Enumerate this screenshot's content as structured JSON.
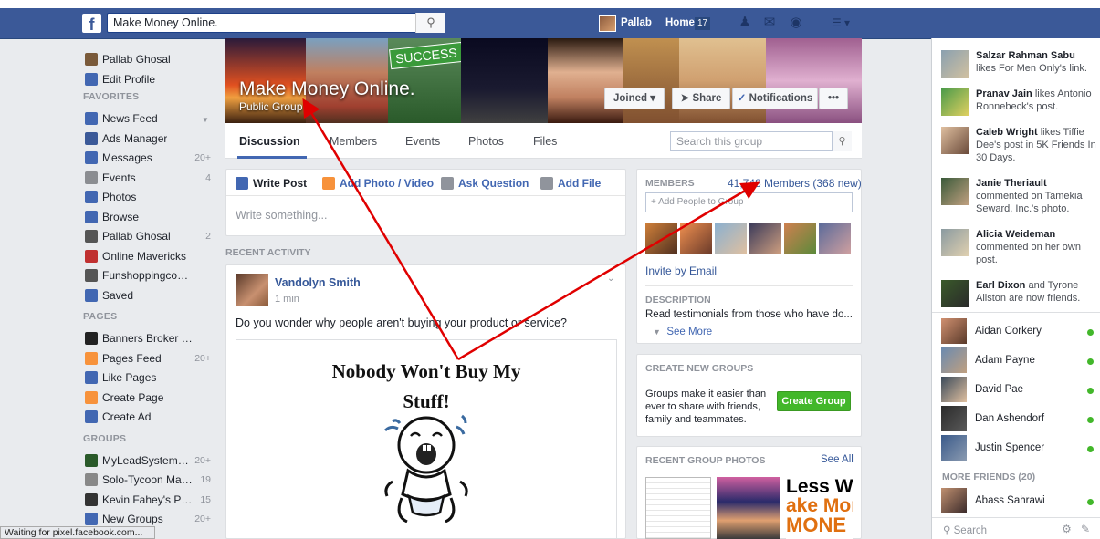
{
  "topbar": {
    "search_value": "Make Money Online.",
    "user_name": "Pallab",
    "home_label": "Home",
    "home_count": "17",
    "colors": {
      "brand": "#3b5998"
    }
  },
  "left_nav": {
    "profile": [
      {
        "label": "Pallab Ghosal",
        "icon": "profile-avatar"
      },
      {
        "label": "Edit Profile",
        "icon": "pencil-icon"
      }
    ],
    "favorites_heading": "FAVORITES",
    "favorites": [
      {
        "label": "News Feed",
        "count": "",
        "icon": "news-feed-icon"
      },
      {
        "label": "Ads Manager",
        "count": "",
        "icon": "chart-icon"
      },
      {
        "label": "Messages",
        "count": "20+",
        "icon": "messages-icon"
      },
      {
        "label": "Events",
        "count": "4",
        "icon": "calendar-icon"
      },
      {
        "label": "Photos",
        "count": "",
        "icon": "photos-icon"
      },
      {
        "label": "Browse",
        "count": "",
        "icon": "browse-icon"
      },
      {
        "label": "Pallab Ghosal",
        "count": "2",
        "icon": "page-icon"
      },
      {
        "label": "Online Mavericks",
        "count": "",
        "icon": "mavericks-icon"
      },
      {
        "label": "Funshoppingcoach",
        "count": "",
        "icon": "group-icon"
      },
      {
        "label": "Saved",
        "count": "",
        "icon": "bookmark-icon"
      }
    ],
    "pages_heading": "PAGES",
    "pages": [
      {
        "label": "Banners Broker India",
        "count": "",
        "icon": "page-icon"
      },
      {
        "label": "Pages Feed",
        "count": "20+",
        "icon": "megaphone-icon"
      },
      {
        "label": "Like Pages",
        "count": "",
        "icon": "like-icon"
      },
      {
        "label": "Create Page",
        "count": "",
        "icon": "plus-icon"
      },
      {
        "label": "Create Ad",
        "count": "",
        "icon": "chart-icon"
      }
    ],
    "groups_heading": "GROUPS",
    "groups": [
      {
        "label": "MyLeadSystemPR...",
        "count": "20+",
        "icon": "group-icon"
      },
      {
        "label": "Solo-Tycoon Maste...",
        "count": "19",
        "icon": "group-icon"
      },
      {
        "label": "Kevin Fahey's PRIV...",
        "count": "15",
        "icon": "group-icon"
      },
      {
        "label": "New Groups",
        "count": "20+",
        "icon": "groups-icon"
      }
    ]
  },
  "group": {
    "name": "Make Money Online.",
    "privacy": "Public Group",
    "cover_text": "SUCCESS",
    "joined": "Joined",
    "share": "Share",
    "notifications": "Notifications",
    "more": "•••",
    "tabs": [
      "Discussion",
      "Members",
      "Events",
      "Photos",
      "Files"
    ],
    "search_placeholder": "Search this group"
  },
  "composer": {
    "write_post": "Write Post",
    "add_photo": "Add Photo / Video",
    "ask_question": "Ask Question",
    "add_file": "Add File",
    "placeholder": "Write something..."
  },
  "activity": {
    "heading": "RECENT ACTIVITY",
    "post": {
      "author": "Vandolyn Smith",
      "time": "1 min",
      "text": "Do you wonder why people aren't buying your product or service?",
      "image_title_1": "Nobody Won't Buy My",
      "image_title_2": "Stuff!"
    }
  },
  "members_card": {
    "heading": "MEMBERS",
    "count": "41,748 Members (368 new)",
    "add_placeholder": "+ Add People to Group",
    "invite": "Invite by Email",
    "description_heading": "DESCRIPTION",
    "description": "Read testimonials from those who have do...",
    "see_more": "See More"
  },
  "create_group_card": {
    "heading": "CREATE NEW GROUPS",
    "text_1": "Groups make it easier than",
    "text_2": "ever to share with friends,",
    "text_3": "family and teammates.",
    "button": "Create Group"
  },
  "photos_card": {
    "heading": "RECENT GROUP PHOTOS",
    "see_all": "See All",
    "photo3_line1": "Less Wo",
    "photo3_line2": "ake Mor",
    "photo3_line3": "MONE"
  },
  "ticker": [
    {
      "name": "Salzar Rahman Sabu",
      "rest": " likes For Men Only's link."
    },
    {
      "name": "Pranav Jain",
      "rest": " likes Antonio Ronnebeck's post."
    },
    {
      "name": "Caleb Wright",
      "rest": " likes Tiffie Dee's post in 5K Friends In 30 Days."
    },
    {
      "name": "Janie Theriault",
      "rest": " commented on Tamekia Seward, Inc.'s photo."
    },
    {
      "name": "Alicia Weideman",
      "rest": " commented on her own post."
    },
    {
      "name": "Earl Dixon",
      "rest": " and Tyrone Allston are now friends."
    }
  ],
  "chat": {
    "online": [
      "Aidan Corkery",
      "Adam Payne",
      "David Pae",
      "Dan Ashendorf",
      "Justin Spencer"
    ],
    "more_heading": "MORE FRIENDS (20)",
    "more": [
      "Abass Sahrawi"
    ],
    "search_placeholder": "Search"
  },
  "status_bar": "Waiting for pixel.facebook.com..."
}
